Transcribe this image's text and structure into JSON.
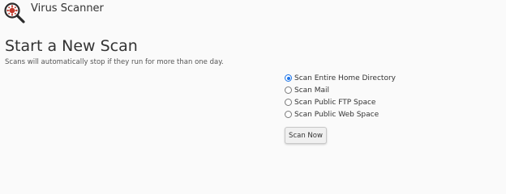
{
  "header": {
    "title": "Virus Scanner",
    "icon": "virus-magnifier-icon"
  },
  "main": {
    "title": "Start a New Scan",
    "subtitle": "Scans will automatically stop if they run for more than one day.",
    "options": [
      {
        "label": "Scan Entire Home Directory",
        "checked": true
      },
      {
        "label": "Scan Mail",
        "checked": false
      },
      {
        "label": "Scan Public FTP Space",
        "checked": false
      },
      {
        "label": "Scan Public Web Space",
        "checked": false
      }
    ],
    "button_label": "Scan Now"
  },
  "colors": {
    "background": "#fafafa",
    "text": "#333333",
    "radio_accent": "#1a73e8",
    "icon_red": "#c0392b",
    "icon_dark": "#2b2b2b"
  }
}
